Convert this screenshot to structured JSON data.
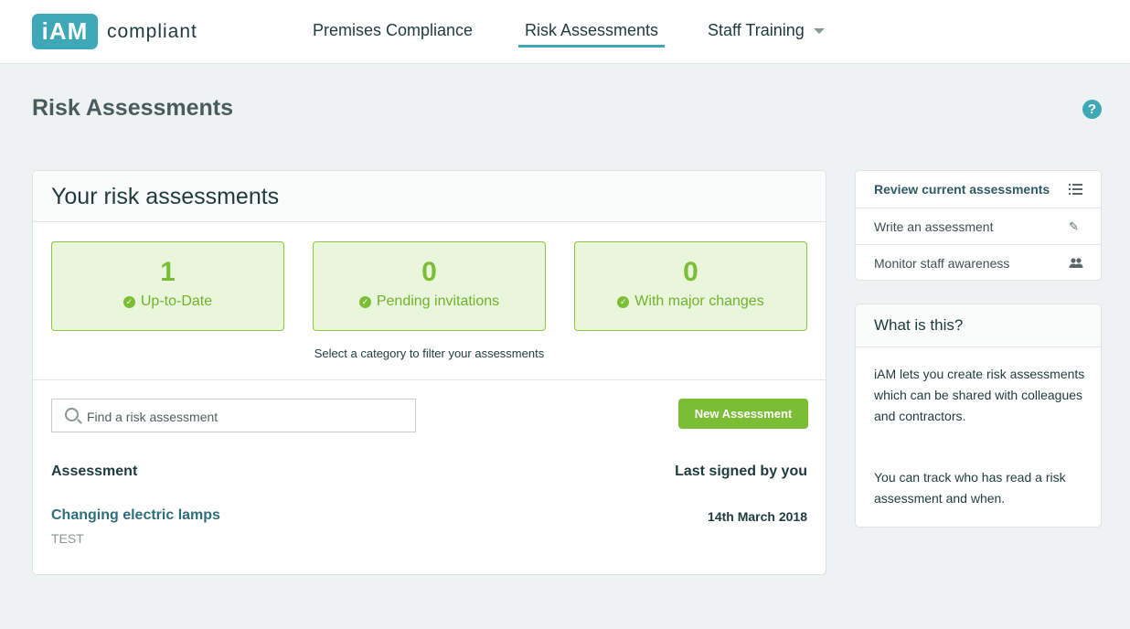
{
  "brand": {
    "logo_mark": "iAM",
    "logo_text": "compliant",
    "accent": "#3ea7b8",
    "green": "#7cbd36"
  },
  "nav": {
    "items": [
      {
        "label": "Premises Compliance",
        "active": false
      },
      {
        "label": "Risk Assessments",
        "active": true
      },
      {
        "label": "Staff Training",
        "active": false,
        "has_dropdown": true
      }
    ]
  },
  "page": {
    "title": "Risk Assessments",
    "help_icon": "question-circle-icon",
    "help_glyph": "?"
  },
  "main": {
    "card_title": "Your risk assessments",
    "stats": [
      {
        "value": "1",
        "label": "Up-to-Date"
      },
      {
        "value": "0",
        "label": "Pending invitations"
      },
      {
        "value": "0",
        "label": "With major changes"
      }
    ],
    "filter_hint": "Select a category to filter your assessments",
    "search": {
      "placeholder": "Find a risk assessment",
      "value": ""
    },
    "new_button_label": "New Assessment",
    "columns": {
      "assessment": "Assessment",
      "last_signed": "Last signed by you"
    },
    "rows": [
      {
        "title": "Changing electric lamps",
        "subtitle": "TEST",
        "date": "14th March 2018"
      }
    ]
  },
  "sidebar": {
    "menu": [
      {
        "label": "Review current assessments",
        "icon": "list-icon",
        "active": true
      },
      {
        "label": "Write an assessment",
        "icon": "pencil-icon",
        "active": false
      },
      {
        "label": "Monitor staff awareness",
        "icon": "users-icon",
        "active": false
      }
    ],
    "info": {
      "title": "What is this?",
      "paragraphs": [
        "iAM lets you create risk assessments which can be shared with colleagues and contractors.",
        "You can track who has read a risk assessment and when."
      ]
    }
  }
}
